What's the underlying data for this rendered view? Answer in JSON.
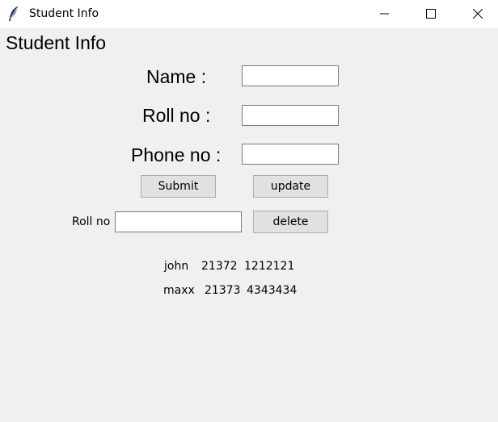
{
  "window": {
    "title": "Student Info",
    "icon": "feather-icon"
  },
  "heading": "Student Info",
  "form": {
    "name_label": "Name :",
    "name_value": "",
    "roll_label": "Roll no :",
    "roll_value": "",
    "phone_label": "Phone no :",
    "phone_value": ""
  },
  "buttons": {
    "submit": "Submit",
    "update": "update",
    "delete": "delete"
  },
  "delete_row": {
    "label": "Roll no",
    "value": ""
  },
  "records": [
    {
      "name": "john",
      "roll": "21372",
      "phone": "1212121"
    },
    {
      "name": "maxx",
      "roll": "21373",
      "phone": "4343434"
    }
  ]
}
